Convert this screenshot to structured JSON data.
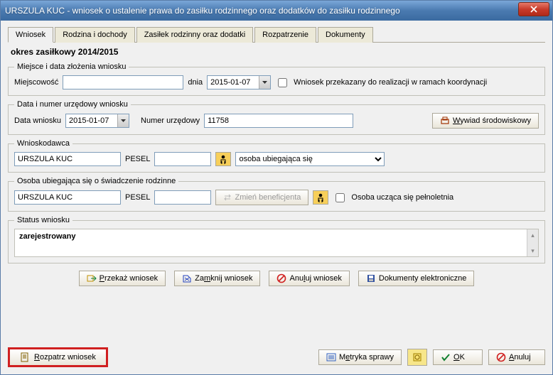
{
  "window": {
    "title": "URSZULA KUC - wniosek o ustalenie prawa do zasiłku rodzinnego oraz dodatków do zasiłku rodzinnego"
  },
  "tabs": {
    "t0": "Wniosek",
    "t1": "Rodzina i dochody",
    "t2": "Zasiłek rodzinny oraz dodatki",
    "t3": "Rozpatrzenie",
    "t4": "Dokumenty"
  },
  "period": "okres zasiłkowy 2014/2015",
  "section_place": {
    "legend": "Miejsce i data złożenia wniosku",
    "miejscowosc_label": "Miejscowość",
    "miejscowosc_value": "",
    "dnia_label": "dnia",
    "dnia_value": "2015-01-07",
    "koordynacja_label": "Wniosek przekazany do realizacji w ramach koordynacji"
  },
  "section_data": {
    "legend": "Data i numer urzędowy wniosku",
    "data_label": "Data wniosku",
    "data_value": "2015-01-07",
    "numer_label": "Numer urzędowy",
    "numer_value": "11758",
    "wywiad_btn": "Wywiad środowiskowy"
  },
  "section_wnioskodawca": {
    "legend": "Wnioskodawca",
    "name": "URSZULA KUC",
    "pesel_label": "PESEL",
    "pesel_value": "",
    "role_value": "osoba ubiegająca się"
  },
  "section_osoba": {
    "legend": "Osoba ubiegająca się o świadczenie rodzinne",
    "name": "URSZULA KUC",
    "pesel_label": "PESEL",
    "pesel_value": "",
    "zmien_btn": "Zmień beneficjenta",
    "pelnoletnia_label": "Osoba ucząca się pełnoletnia"
  },
  "section_status": {
    "legend": "Status wniosku",
    "value": "zarejestrowany"
  },
  "actions": {
    "przekaz": "Przekaż wniosek",
    "zamknij": "Zamknij wniosek",
    "anuluj_w": "Anuluj wniosek",
    "dokumenty": "Dokumenty elektroniczne"
  },
  "bottom": {
    "rozpatrz": "Rozpatrz wniosek",
    "metryka": "Metryka sprawy",
    "ok": "OK",
    "anuluj": "Anuluj"
  }
}
